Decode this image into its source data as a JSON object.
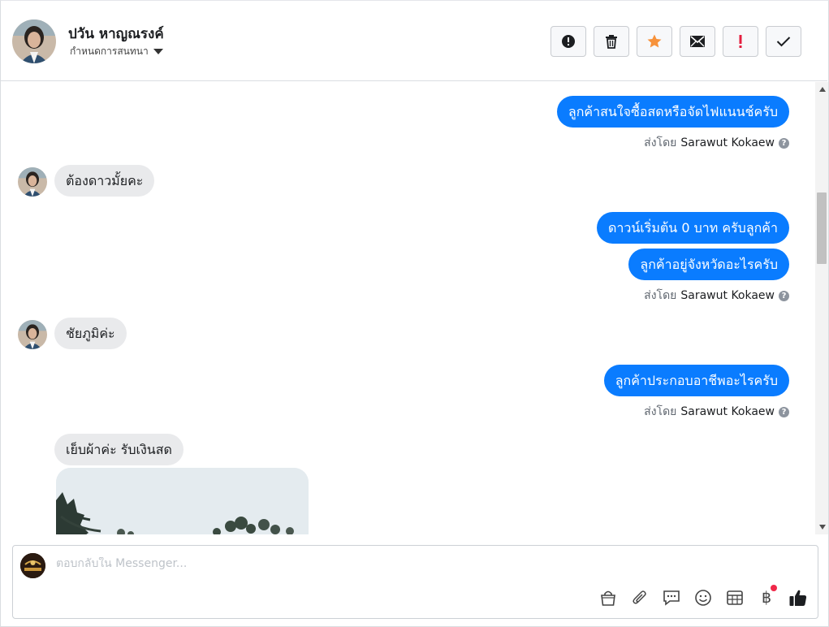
{
  "header": {
    "contact_name": "ปวัน หาญณรงค์",
    "assign_label": "กำหนดการสนทนา",
    "actions": [
      {
        "name": "spam-report-button",
        "icon": "exclamation-circle-icon"
      },
      {
        "name": "delete-button",
        "icon": "trash-icon"
      },
      {
        "name": "star-button",
        "icon": "star-icon",
        "color": "#f7923b"
      },
      {
        "name": "mark-unread-button",
        "icon": "envelope-icon"
      },
      {
        "name": "follow-up-button",
        "icon": "exclamation-icon",
        "color": "#e41e3f"
      },
      {
        "name": "mark-done-button",
        "icon": "check-icon"
      }
    ]
  },
  "thread": {
    "messages": [
      {
        "dir": "out",
        "text": "ลูกค้าสนใจซื้อสดหรือจัดไฟแนนช์ครับ"
      },
      {
        "dir": "sent_by",
        "prefix": "ส่งโดย",
        "sender": "Sarawut Kokaew"
      },
      {
        "dir": "in",
        "text": "ต้องดาวมั้ยคะ"
      },
      {
        "dir": "out",
        "text": "ดาวน์เริ่มต้น 0 บาท ครับลูกค้า"
      },
      {
        "dir": "out",
        "text": "ลูกค้าอยู่จังหวัดอะไรครับ"
      },
      {
        "dir": "sent_by",
        "prefix": "ส่งโดย",
        "sender": "Sarawut Kokaew"
      },
      {
        "dir": "in",
        "text": "ชัยภูมิค่ะ"
      },
      {
        "dir": "out",
        "text": "ลูกค้าประกอบอาชีพอะไรครับ"
      },
      {
        "dir": "sent_by",
        "prefix": "ส่งโดย",
        "sender": "Sarawut Kokaew"
      },
      {
        "dir": "in",
        "text": "เย็บผ้าค่ะ รับเงินสด"
      }
    ],
    "help_glyph": "?"
  },
  "composer": {
    "placeholder": "ตอบกลับใน Messenger...",
    "tools": [
      "shopping-bag-icon",
      "paperclip-icon",
      "saved-reply-icon",
      "emoji-icon",
      "table-icon",
      "baht-payment-icon",
      "thumbs-up-icon"
    ],
    "baht_symbol": "฿"
  },
  "colors": {
    "outgoing_bubble": "#0a7cff",
    "incoming_bubble": "#e9eaec",
    "notification_dot": "#f02849"
  }
}
